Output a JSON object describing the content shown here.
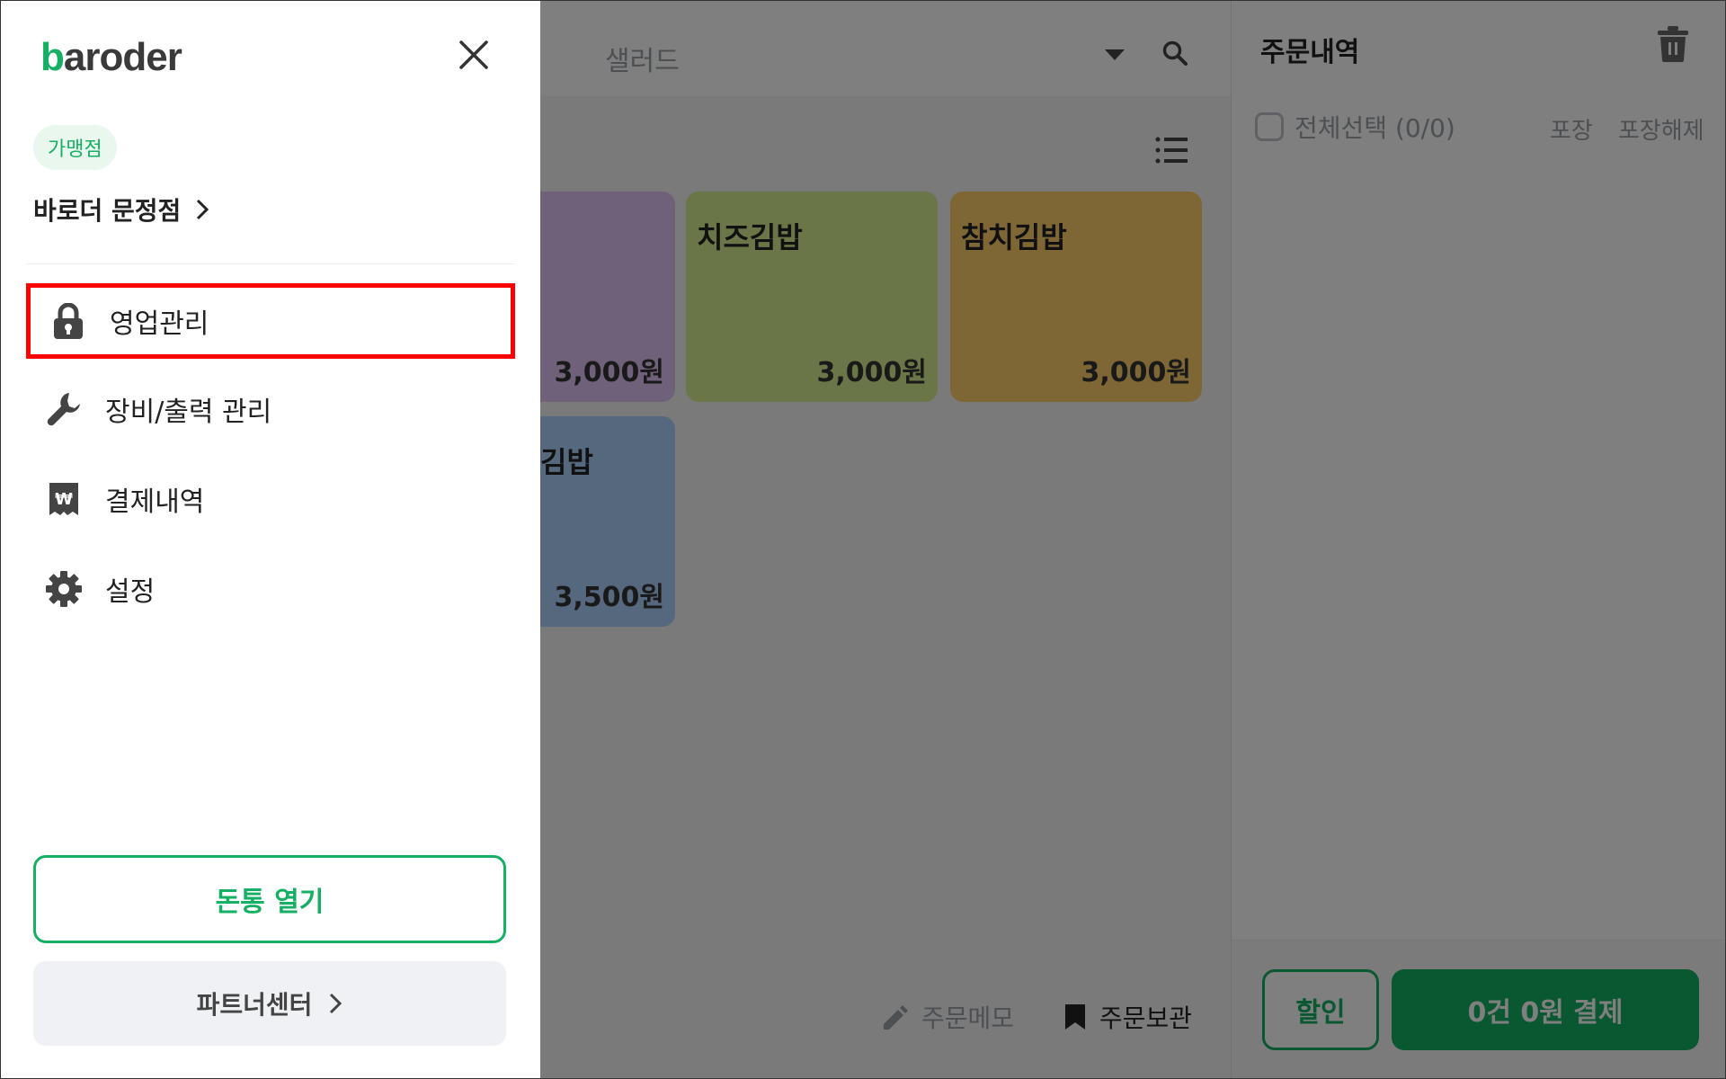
{
  "header": {
    "category": "샐러드"
  },
  "menu_cards": [
    {
      "name": "",
      "price": "3,000원",
      "color": "#e0c3f5"
    },
    {
      "name": "치즈김밥",
      "price": "3,000원",
      "color": "#d4ec8e"
    },
    {
      "name": "참치김밥",
      "price": "3,000원",
      "color": "#fccf6a"
    },
    {
      "name": "김밥",
      "price": "3,500원",
      "color": "#aad0fb"
    }
  ],
  "bottom_actions": {
    "memo": "주문메모",
    "hold": "주문보관"
  },
  "order_panel": {
    "title": "주문내역",
    "select_all": "전체선택 (0/0)",
    "pack": "포장",
    "unpack": "포장해제",
    "discount": "할인",
    "pay": "0건 0원 결제"
  },
  "drawer": {
    "logo": {
      "accent": "b",
      "rest": "aroder"
    },
    "badge": "가맹점",
    "store_name": "바로더 문정점",
    "menu": [
      {
        "label": "영업관리",
        "icon": "lock-icon"
      },
      {
        "label": "장비/출력 관리",
        "icon": "wrench-icon"
      },
      {
        "label": "결제내역",
        "icon": "receipt-icon"
      },
      {
        "label": "설정",
        "icon": "gear-icon"
      }
    ],
    "cashbox_button": "돈통 열기",
    "partner_button": "파트너센터"
  },
  "colors": {
    "brand": "#15b063",
    "highlight": "#ff0000"
  }
}
